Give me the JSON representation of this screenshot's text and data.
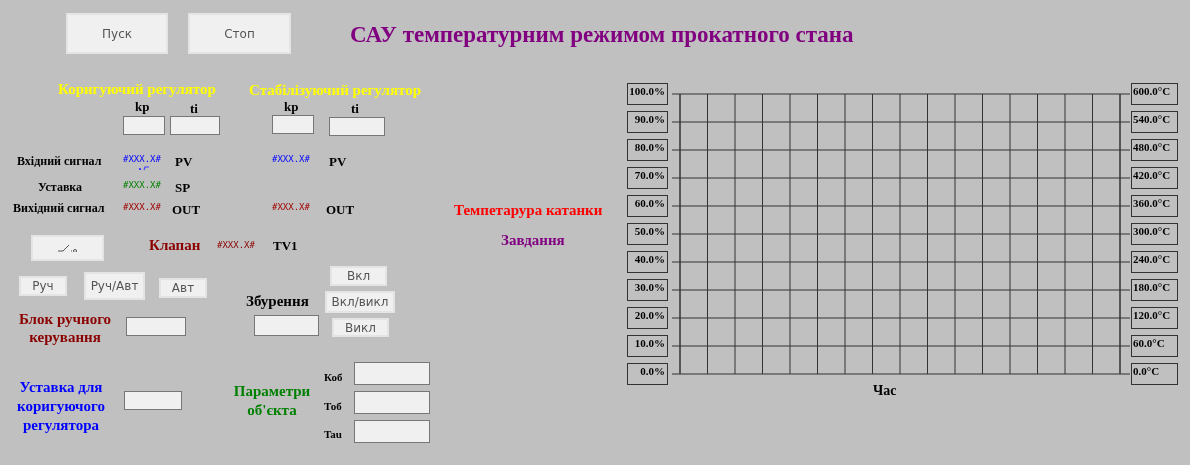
{
  "title": "САУ температурним режимом прокатного стана",
  "buttons": [
    {
      "label": "Пуск"
    },
    {
      "label": "Стоп"
    }
  ],
  "correcting": {
    "title": "Коригуючий регулятор",
    "kp_label": "kp",
    "ti_label": "ti"
  },
  "stabilizing": {
    "title": "Стабілізуючий регулятор",
    "kp_label": "kp",
    "ti_label": "ti"
  },
  "signal_rows": [
    {
      "kind": "input",
      "label": "Вхідний сигнал",
      "value": "#XXX.X#",
      "tag": "PV",
      "right_value": "#XXX.X#",
      "right_tag": "PV"
    },
    {
      "kind": "setpoint",
      "label": "Уставка",
      "value": "#XXX.X#",
      "tag": "SP"
    },
    {
      "kind": "output",
      "label": "Вихідний сигнал",
      "value": "#XXX.X#",
      "tag": "OUT",
      "right_value": "#XXX.X#",
      "right_tag": "OUT"
    }
  ],
  "valve": {
    "label": "Клапан",
    "value": "#XXX.X#",
    "tag": "TV1"
  },
  "mode_buttons": [
    {
      "label": "Руч"
    },
    {
      "label": "Руч/Авт"
    },
    {
      "label": "Авт"
    }
  ],
  "manual_block": {
    "label": "Блок ручного керування"
  },
  "disturbance": {
    "label": "Збурення",
    "buttons": [
      {
        "label": "Вкл"
      },
      {
        "label": "Вкл/викл"
      },
      {
        "label": "Викл"
      }
    ]
  },
  "setpoint": {
    "label": "Уставка для коригуючого регулятора"
  },
  "object_params": {
    "label": "Параметри об'єкта",
    "params": [
      {
        "label": "Коб"
      },
      {
        "label": "Тоб"
      },
      {
        "label": "Tau"
      }
    ]
  },
  "legend": [
    {
      "label": "Темпетарура катанки",
      "color": "#ff0000"
    },
    {
      "label": "Завдання",
      "color": "#800080"
    }
  ],
  "trend": {
    "left_scale": [
      "100.0%",
      "90.0%",
      "80.0%",
      "70.0%",
      "60.0%",
      "50.0%",
      "40.0%",
      "30.0%",
      "20.0%",
      "10.0%",
      "0.0%"
    ],
    "right_scale": [
      "600.0°C",
      "540.0°C",
      "480.0°C",
      "420.0°C",
      "360.0°C",
      "300.0°C",
      "240.0°C",
      "180.0°C",
      "120.0°C",
      "60.0°C",
      "0.0°C"
    ],
    "xlabel": "Час"
  }
}
